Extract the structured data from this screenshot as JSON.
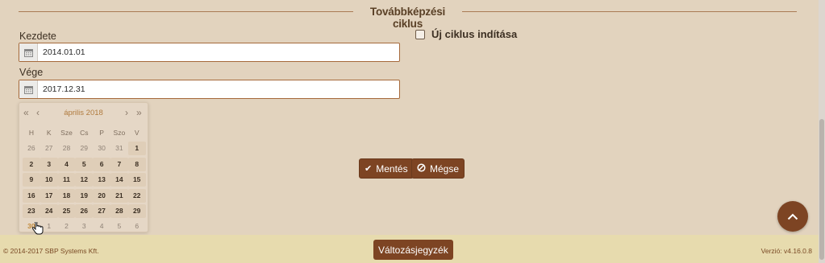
{
  "section": {
    "title": "Továbbképzési ciklus"
  },
  "start": {
    "label": "Kezdete",
    "value": "2014.01.01"
  },
  "end": {
    "label": "Vége",
    "value": "2017.12.31"
  },
  "new_cycle": {
    "label": "Új ciklus indítása",
    "checked": false
  },
  "datepicker": {
    "month_label": "április 2018",
    "weekdays": [
      "H",
      "K",
      "Sze",
      "Cs",
      "P",
      "Szo",
      "V"
    ],
    "weeks": [
      [
        {
          "d": "26",
          "t": "other"
        },
        {
          "d": "27",
          "t": "other"
        },
        {
          "d": "28",
          "t": "other"
        },
        {
          "d": "29",
          "t": "other"
        },
        {
          "d": "30",
          "t": "other"
        },
        {
          "d": "31",
          "t": "other"
        },
        {
          "d": "1",
          "t": "cur"
        }
      ],
      [
        {
          "d": "2",
          "t": "cur"
        },
        {
          "d": "3",
          "t": "cur"
        },
        {
          "d": "4",
          "t": "cur"
        },
        {
          "d": "5",
          "t": "cur"
        },
        {
          "d": "6",
          "t": "cur"
        },
        {
          "d": "7",
          "t": "cur"
        },
        {
          "d": "8",
          "t": "cur"
        }
      ],
      [
        {
          "d": "9",
          "t": "cur"
        },
        {
          "d": "10",
          "t": "cur"
        },
        {
          "d": "11",
          "t": "cur"
        },
        {
          "d": "12",
          "t": "cur"
        },
        {
          "d": "13",
          "t": "cur"
        },
        {
          "d": "14",
          "t": "cur"
        },
        {
          "d": "15",
          "t": "cur"
        }
      ],
      [
        {
          "d": "16",
          "t": "cur"
        },
        {
          "d": "17",
          "t": "cur"
        },
        {
          "d": "18",
          "t": "cur"
        },
        {
          "d": "19",
          "t": "cur"
        },
        {
          "d": "20",
          "t": "cur"
        },
        {
          "d": "21",
          "t": "cur"
        },
        {
          "d": "22",
          "t": "cur"
        }
      ],
      [
        {
          "d": "23",
          "t": "cur"
        },
        {
          "d": "24",
          "t": "cur"
        },
        {
          "d": "25",
          "t": "cur"
        },
        {
          "d": "26",
          "t": "cur"
        },
        {
          "d": "27",
          "t": "cur"
        },
        {
          "d": "28",
          "t": "cur"
        },
        {
          "d": "29",
          "t": "cur"
        }
      ],
      [
        {
          "d": "30",
          "t": "today"
        },
        {
          "d": "1",
          "t": "other"
        },
        {
          "d": "2",
          "t": "other"
        },
        {
          "d": "3",
          "t": "other"
        },
        {
          "d": "4",
          "t": "other"
        },
        {
          "d": "5",
          "t": "other"
        },
        {
          "d": "6",
          "t": "other"
        }
      ]
    ]
  },
  "actions": {
    "save_label": "Mentés",
    "cancel_label": "Mégse"
  },
  "footer": {
    "copyright": "© 2014-2017 SBP Systems Kft.",
    "changelog_label": "Változásjegyzék",
    "version": "Verzió: v4.16.0.8"
  },
  "colors": {
    "accent": "#7d4423",
    "background": "#e2d3be",
    "footer": "#e7dbae",
    "month": "#b07b3e"
  }
}
